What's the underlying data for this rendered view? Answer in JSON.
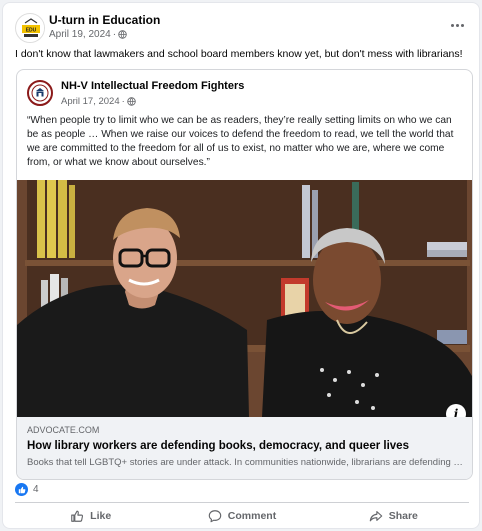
{
  "post": {
    "author": "U-turn in Education",
    "date": "April 19, 2024",
    "privacy_icon": "globe-icon",
    "text": "I don't know that lawmakers and school board members know yet, but don't mess with librarians!"
  },
  "shared_post": {
    "author": "NH-V Intellectual Freedom Fighters",
    "date": "April 17, 2024",
    "quote": "“When people try to limit who we can be as readers, they’re really setting limits on who we can be as people … When we raise our voices to defend the freedom to read, we tell the world that we are committed to the freedom for all of us to exist, no matter who we are, where we come from, or what we know about ourselves.”"
  },
  "link": {
    "domain": "ADVOCATE.COM",
    "title": "How library workers are defending books, democracy, and queer lives",
    "description": "Books that tell LGBTQ+ stories are under attack. In communities nationwide, librarians are defending the freedom to read."
  },
  "reactions": {
    "count": "4",
    "icon": "like-icon"
  },
  "actions": {
    "like": "Like",
    "comment": "Comment",
    "share": "Share"
  },
  "colors": {
    "accent": "#1877f2",
    "secondary_text": "#65676b"
  }
}
